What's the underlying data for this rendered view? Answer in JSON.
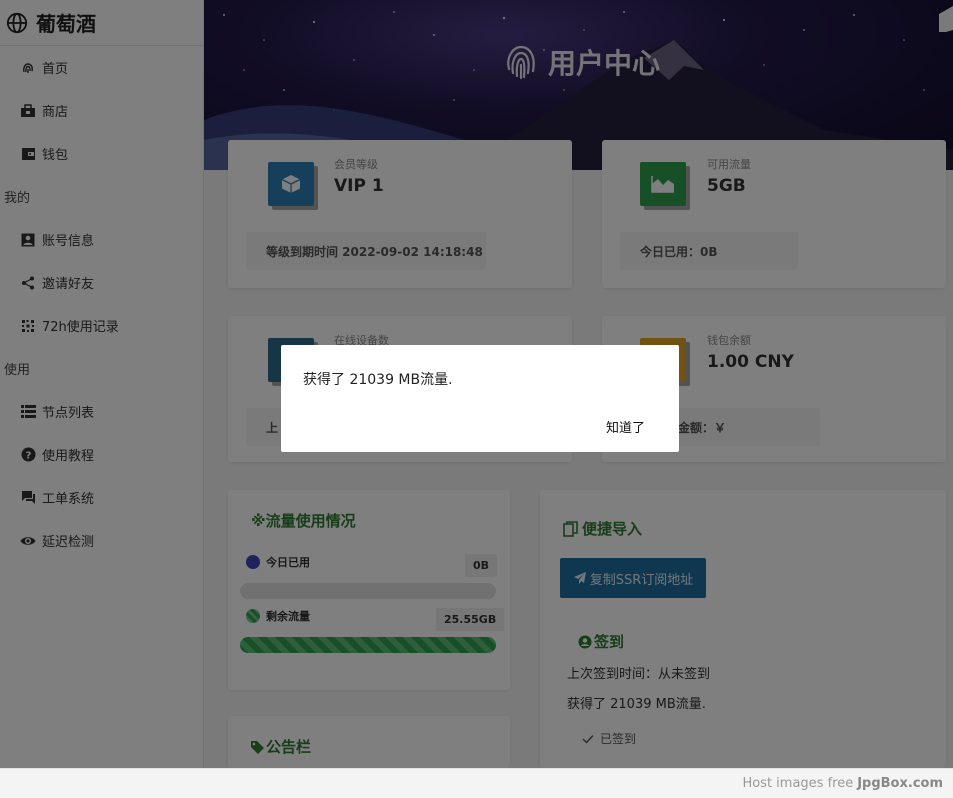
{
  "brand": {
    "name": "葡萄酒"
  },
  "sidebar": {
    "items": [
      {
        "label": "首页",
        "icon": "fingerprint-icon"
      },
      {
        "label": "商店",
        "icon": "shop-icon"
      },
      {
        "label": "钱包",
        "icon": "wallet-icon"
      }
    ],
    "section_mine": "我的",
    "mine_items": [
      {
        "label": "账号信息",
        "icon": "account-icon"
      },
      {
        "label": "邀请好友",
        "icon": "share-icon"
      },
      {
        "label": "72h使用记录",
        "icon": "dots-icon"
      }
    ],
    "section_use": "使用",
    "use_items": [
      {
        "label": "节点列表",
        "icon": "list-icon"
      },
      {
        "label": "使用教程",
        "icon": "help-icon"
      },
      {
        "label": "工单系统",
        "icon": "ticket-icon"
      },
      {
        "label": "延迟检测",
        "icon": "eye-icon"
      }
    ]
  },
  "hero": {
    "title": "用户中心"
  },
  "cards": {
    "vip": {
      "label": "会员等级",
      "value": "VIP 1",
      "foot": "等级到期时间 2022-09-02 14:18:48",
      "color": "#2d7eb8"
    },
    "traffic": {
      "label": "可用流量",
      "value": "5GB",
      "foot": "今日已用：0B",
      "color": "#2e9e4f"
    },
    "devices": {
      "label": "在线设备数",
      "foot": "上",
      "color": "#2d6a8a"
    },
    "wallet": {
      "label": "钱包余额",
      "value": "1.00 CNY",
      "foot": "金额：￥",
      "color": "#e0a526"
    }
  },
  "usage": {
    "title": "※流量使用情况",
    "today_label": "今日已用",
    "today_value": "0B",
    "remain_label": "剩余流量",
    "remain_value": "25.55GB",
    "remain_fraction": 1.0
  },
  "notice": {
    "title": "公告栏"
  },
  "quick": {
    "title": "便捷导入",
    "ssr_button": "复制SSR订阅地址",
    "checkin_title": "签到",
    "last_checkin": "上次签到时间：从未签到",
    "result": "获得了 21039 MB流量.",
    "status": "已签到"
  },
  "dialog": {
    "message": "获得了 21039 MB流量.",
    "button": "知道了"
  },
  "footer": {
    "text": "Host images free",
    "brand": "JpgBox.com"
  }
}
